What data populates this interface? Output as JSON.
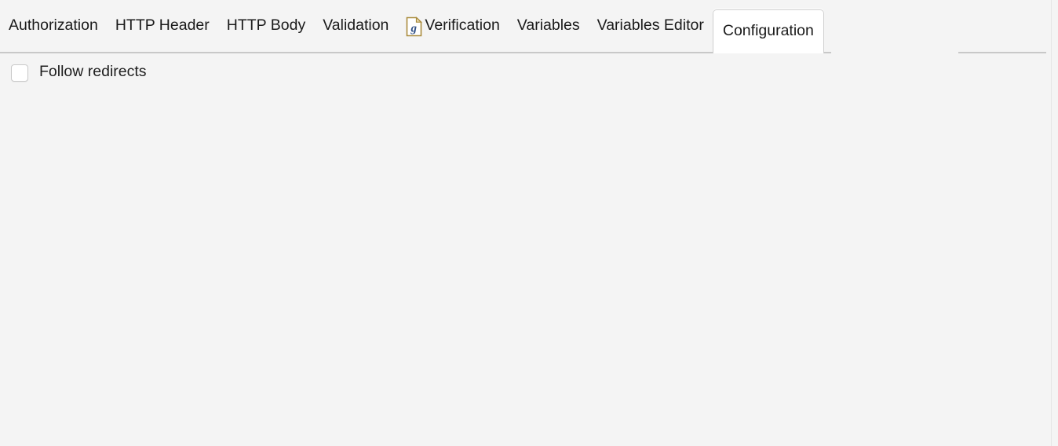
{
  "panel": {
    "background_color": "#f4f4f4",
    "selected_tab_background": "#ffffff",
    "border_color": "#c8c8c8"
  },
  "tabstrip": {
    "tabs": [
      {
        "id": "authorization",
        "label": "Authorization",
        "selected": false,
        "icon": null
      },
      {
        "id": "http-header",
        "label": "HTTP Header",
        "selected": false,
        "icon": null
      },
      {
        "id": "http-body",
        "label": "HTTP Body",
        "selected": false,
        "icon": null
      },
      {
        "id": "validation",
        "label": "Validation",
        "selected": false,
        "icon": null
      },
      {
        "id": "verification",
        "label": "Verification",
        "selected": false,
        "icon": "groovy-script-file-icon"
      },
      {
        "id": "variables",
        "label": "Variables",
        "selected": false,
        "icon": null
      },
      {
        "id": "variables-editor",
        "label": "Variables Editor",
        "selected": false,
        "icon": null
      },
      {
        "id": "configuration",
        "label": "Configuration",
        "selected": true,
        "icon": null
      }
    ]
  },
  "content": {
    "options": [
      {
        "id": "follow-redirects",
        "label": "Follow redirects",
        "checked": false
      }
    ]
  },
  "icon_colors": {
    "document_border": "#a98b3c",
    "document_fill": "#ffffff",
    "letter": "#2f4f86",
    "fold": "#e8dcb5"
  }
}
